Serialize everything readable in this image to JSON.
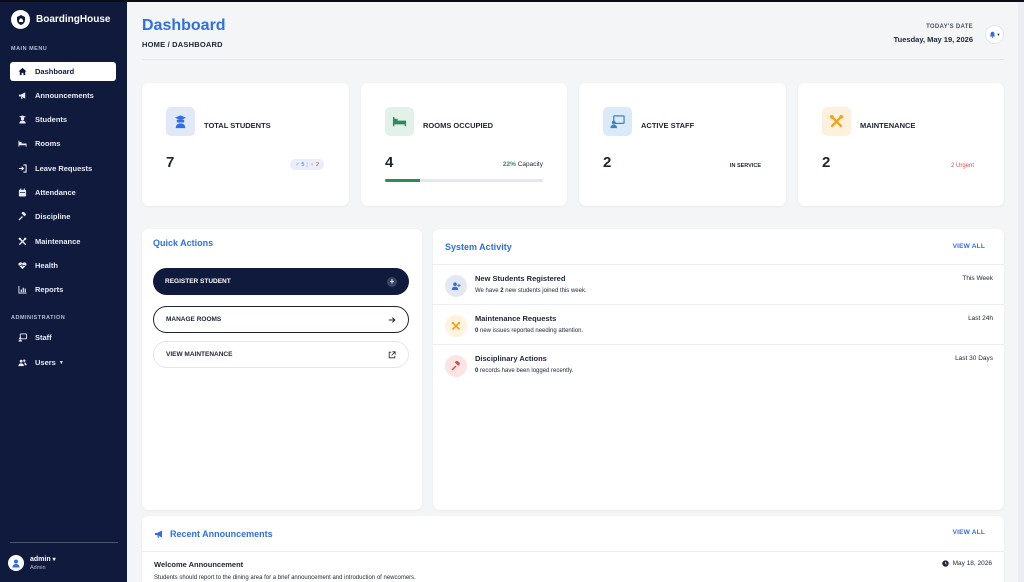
{
  "app": {
    "name": "BoardingHouse"
  },
  "sidebar": {
    "main_menu_label": "MAIN MENU",
    "admin_label": "ADMINISTRATION",
    "items": [
      {
        "label": "Dashboard",
        "icon": "home-icon"
      },
      {
        "label": "Announcements",
        "icon": "megaphone-icon"
      },
      {
        "label": "Students",
        "icon": "student-icon"
      },
      {
        "label": "Rooms",
        "icon": "bed-icon"
      },
      {
        "label": "Leave Requests",
        "icon": "leave-icon"
      },
      {
        "label": "Attendance",
        "icon": "calendar-icon"
      },
      {
        "label": "Discipline",
        "icon": "gavel-icon"
      },
      {
        "label": "Maintenance",
        "icon": "tools-icon"
      },
      {
        "label": "Health",
        "icon": "heartbeat-icon"
      },
      {
        "label": "Reports",
        "icon": "chart-icon"
      }
    ],
    "admin_items": [
      {
        "label": "Staff",
        "icon": "staff-icon"
      },
      {
        "label": "Users",
        "icon": "users-icon"
      }
    ],
    "user": {
      "name": "admin",
      "role": "Admin"
    }
  },
  "header": {
    "title": "Dashboard",
    "breadcrumb": "HOME / DASHBOARD",
    "date_label": "TODAY'S DATE",
    "date_value": "Tuesday, May 19, 2026"
  },
  "stats": {
    "students": {
      "label": "TOTAL STUDENTS",
      "value": "7",
      "male": "5",
      "female": "2"
    },
    "rooms": {
      "label": "ROOMS OCCUPIED",
      "value": "4",
      "capacity_pct": "22%",
      "capacity_label": "Capacity",
      "fill_fraction": 0.22
    },
    "staff": {
      "label": "ACTIVE STAFF",
      "value": "2",
      "status": "IN SERVICE"
    },
    "maintenance": {
      "label": "MAINTENANCE",
      "value": "2",
      "urgent": "2 Urgent"
    }
  },
  "quick_actions": {
    "title": "Quick Actions",
    "register": "REGISTER STUDENT",
    "manage_rooms": "MANAGE ROOMS",
    "view_maintenance": "VIEW MAINTENANCE"
  },
  "activity": {
    "title": "System Activity",
    "view_all": "VIEW ALL",
    "items": [
      {
        "title": "New Students Registered",
        "desc_pre": "We have ",
        "count": "2",
        "desc_post": " new students joined this week.",
        "time": "This Week"
      },
      {
        "title": "Maintenance Requests",
        "desc_pre": "",
        "count": "0",
        "desc_post": " new issues reported needing attention.",
        "time": "Last 24h"
      },
      {
        "title": "Disciplinary Actions",
        "desc_pre": "",
        "count": "0",
        "desc_post": " records have been logged recently.",
        "time": "Last 30 Days"
      }
    ]
  },
  "announcements": {
    "title": "Recent Announcements",
    "view_all": "VIEW ALL",
    "item": {
      "title": "Welcome Announcement",
      "date": "May 18, 2026",
      "body": "Students should report to the dining area for a brief announcement and introduction of newcomers."
    }
  },
  "colors": {
    "accent": "#2f6fe4",
    "sidebar": "#0f1a3c",
    "success": "#2e8b57",
    "danger": "#e04a4a"
  }
}
